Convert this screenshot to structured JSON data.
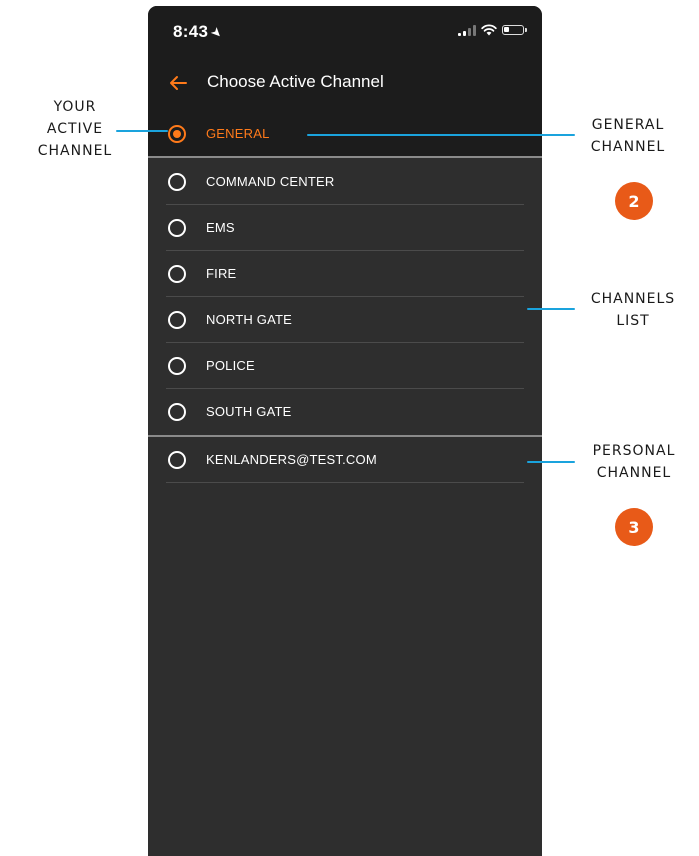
{
  "status_bar": {
    "time": "8:43",
    "location_arrow": "location-arrow-icon"
  },
  "header": {
    "title": "Choose Active Channel",
    "back_icon": "back-arrow-icon"
  },
  "active_channel": {
    "label": "GENERAL"
  },
  "channels": [
    {
      "label": "COMMAND CENTER"
    },
    {
      "label": "EMS"
    },
    {
      "label": "FIRE"
    },
    {
      "label": "NORTH GATE"
    },
    {
      "label": "POLICE"
    },
    {
      "label": "SOUTH GATE"
    }
  ],
  "personal_channel": {
    "label": "KENLANDERS@TEST.COM"
  },
  "annotations": {
    "your_active_channel": [
      "YOUR",
      "ACTIVE",
      "CHANNEL"
    ],
    "general_channel": [
      "GENERAL",
      "CHANNEL"
    ],
    "channels_list": [
      "CHANNELS",
      "LIST"
    ],
    "personal_channel": [
      "PERSONAL",
      "CHANNEL"
    ],
    "badge_2": "2",
    "badge_3": "3"
  },
  "colors": {
    "accent": "#ff7a1a",
    "callout_line": "#1aa3dd",
    "badge": "#e85a18",
    "background": "#2e2e2e",
    "header": "#1c1c1c"
  }
}
